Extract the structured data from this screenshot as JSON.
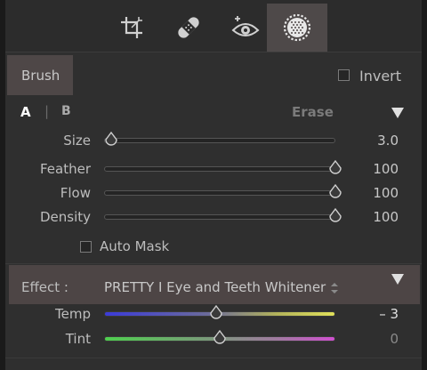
{
  "colors": {
    "panel_bg": "#2f2f2f",
    "active_bg": "#4e4949",
    "text": "#bdbdbd"
  },
  "toolstrip": {
    "tools": [
      {
        "icon": "crop-icon"
      },
      {
        "icon": "healing-bandage-icon"
      },
      {
        "icon": "red-eye-icon"
      },
      {
        "icon": "radial-brush-icon",
        "active": true
      }
    ]
  },
  "brush": {
    "tab_label": "Brush",
    "invert_label": "Invert",
    "invert_checked": false,
    "preset_a": "A",
    "preset_sep": "|",
    "preset_b": "B",
    "erase_label": "Erase",
    "sliders": [
      {
        "label": "Size",
        "value_text": "3.0",
        "fraction": 0.03
      },
      {
        "label": "Feather",
        "value_text": "100",
        "fraction": 1.0
      },
      {
        "label": "Flow",
        "value_text": "100",
        "fraction": 1.0
      },
      {
        "label": "Density",
        "value_text": "100",
        "fraction": 1.0
      }
    ],
    "auto_mask_label": "Auto Mask",
    "auto_mask_checked": false
  },
  "effect": {
    "label": "Effect :",
    "preset": "PRETTY I Eye and Teeth Whitener",
    "stepper_icon": "up-down-stepper-icon",
    "sliders": [
      {
        "label": "Temp",
        "value_text": "– 3",
        "fraction": 0.485
      },
      {
        "label": "Tint",
        "value_text": "0",
        "fraction": 0.5
      }
    ]
  }
}
